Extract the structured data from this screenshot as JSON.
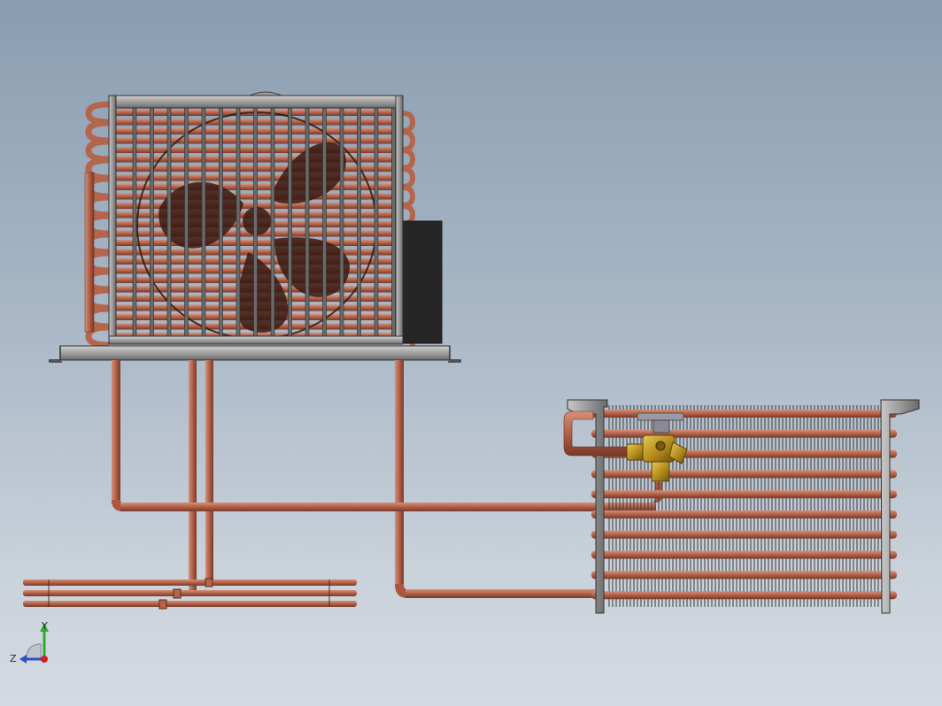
{
  "viewport": {
    "background_top": "#8a9db0",
    "background_bottom": "#d4dae1"
  },
  "colors": {
    "copper": "#b0624a",
    "copper_light": "#d08a70",
    "copper_dark": "#7a3a28",
    "frame_gray": "#8c8c8c",
    "frame_dark": "#3a3a3a",
    "brass": "#c9a22e",
    "electrical_box": "#2a2a2a"
  },
  "triad": {
    "y_label": "Y",
    "z_label": "Z",
    "y_color": "#2eaa2e",
    "z_color": "#2f50c8",
    "x_color": "#d02020"
  }
}
